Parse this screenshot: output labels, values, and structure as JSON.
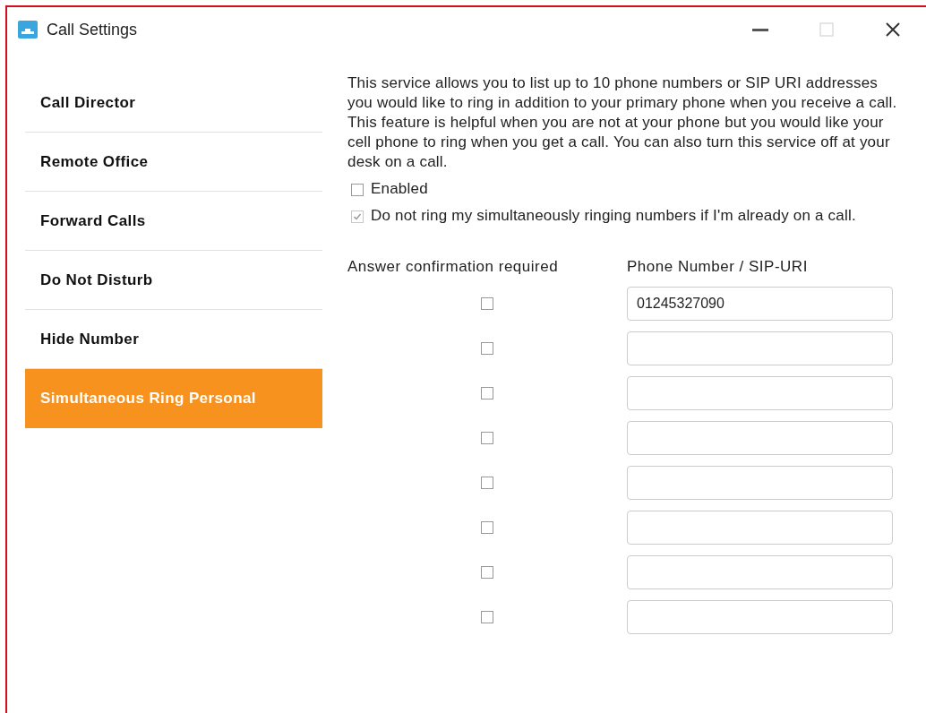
{
  "window": {
    "title": "Call Settings"
  },
  "sidebar": {
    "items": [
      {
        "label": "Call Director",
        "selected": false
      },
      {
        "label": "Remote Office",
        "selected": false
      },
      {
        "label": "Forward Calls",
        "selected": false
      },
      {
        "label": "Do Not Disturb",
        "selected": false
      },
      {
        "label": "Hide Number",
        "selected": false
      },
      {
        "label": "Simultaneous Ring Personal",
        "selected": true
      }
    ]
  },
  "description": "This service allows you to list up to 10 phone numbers or SIP URI addresses you would like to ring in addition to your primary phone when you receive a call. This feature is helpful when you are not at your phone but you would like your cell phone to ring when you get a call. You can also turn this service off at your desk on a call.",
  "options": [
    {
      "label": "Enabled",
      "checked": false,
      "disabled": false
    },
    {
      "label": "Do not ring my simultaneously ringing numbers if I'm already on a call.",
      "checked": true,
      "disabled": true
    }
  ],
  "table": {
    "columns": [
      "Answer confirmation required",
      "Phone Number / SIP-URI"
    ],
    "rows": [
      {
        "confirm": false,
        "number": "01245327090"
      },
      {
        "confirm": false
      },
      {
        "confirm": false
      },
      {
        "confirm": false
      },
      {
        "confirm": false
      },
      {
        "confirm": false
      },
      {
        "confirm": false
      },
      {
        "confirm": false
      }
    ]
  }
}
